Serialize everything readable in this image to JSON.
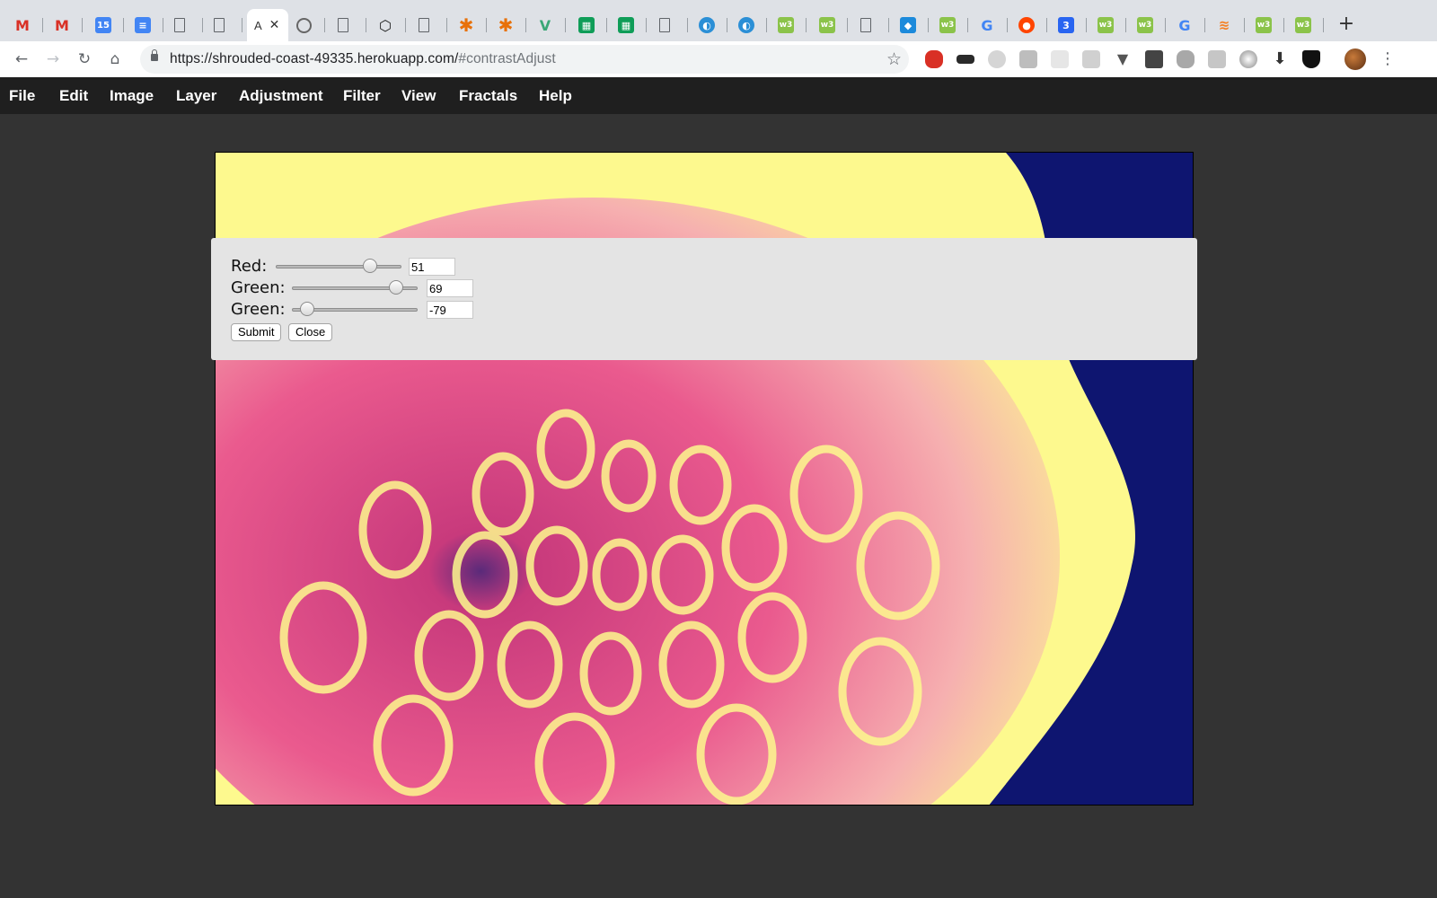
{
  "browser": {
    "active_tab_title": "A",
    "url": {
      "host": "https://shrouded-coast-49335.herokuapp.com/",
      "fragment": "#contrastAdjust"
    },
    "tab_icons": [
      "gmail-icon",
      "gmail-icon",
      "calendar-icon",
      "docs-icon",
      "page-icon",
      "page-icon",
      "active-tab",
      "aperture-icon",
      "page-icon",
      "codepen-icon",
      "page-icon",
      "asterisk-icon",
      "asterisk-icon",
      "vue-icon",
      "sheets-icon",
      "sheets-icon",
      "page-icon",
      "shield-icon",
      "shield-icon",
      "codepen-green-icon",
      "codepen-green-icon",
      "page-icon",
      "bird-icon",
      "codepen-green-icon",
      "google-icon",
      "reddit-icon",
      "css3-icon",
      "codepen-green-icon",
      "codepen-green-icon",
      "google-icon",
      "stackoverflow-icon",
      "codepen-green-icon",
      "codepen-green-icon"
    ],
    "calendar_day": "15",
    "extension_icons": [
      "hand-icon",
      "mask-icon",
      "tag-icon",
      "es-icon",
      "grid-icon",
      "box-icon",
      "vuejs-icon",
      "bulb-icon",
      "fox-icon",
      "printer-icon",
      "circle-icon",
      "download-icon",
      "shield-icon"
    ]
  },
  "menubar": {
    "items": [
      "File",
      "Edit",
      "Image",
      "Layer",
      "Adjustment",
      "Filter",
      "View",
      "Fractals",
      "Help"
    ]
  },
  "dialog": {
    "rows": [
      {
        "label": "Red:",
        "value": "51",
        "level": 0.75
      },
      {
        "label": "Green:",
        "value": "69",
        "level": 0.83
      },
      {
        "label": "Green:",
        "value": "-79",
        "level": 0.12
      }
    ],
    "submit_label": "Submit",
    "close_label": "Close"
  },
  "colors": {
    "workspace_bg": "#333333",
    "menubar_bg": "#1f1f1f",
    "dialog_bg": "#e4e4e4",
    "image_yellow": "#fdf98e",
    "image_pink": "#e84b82",
    "image_navy": "#0e1570"
  }
}
